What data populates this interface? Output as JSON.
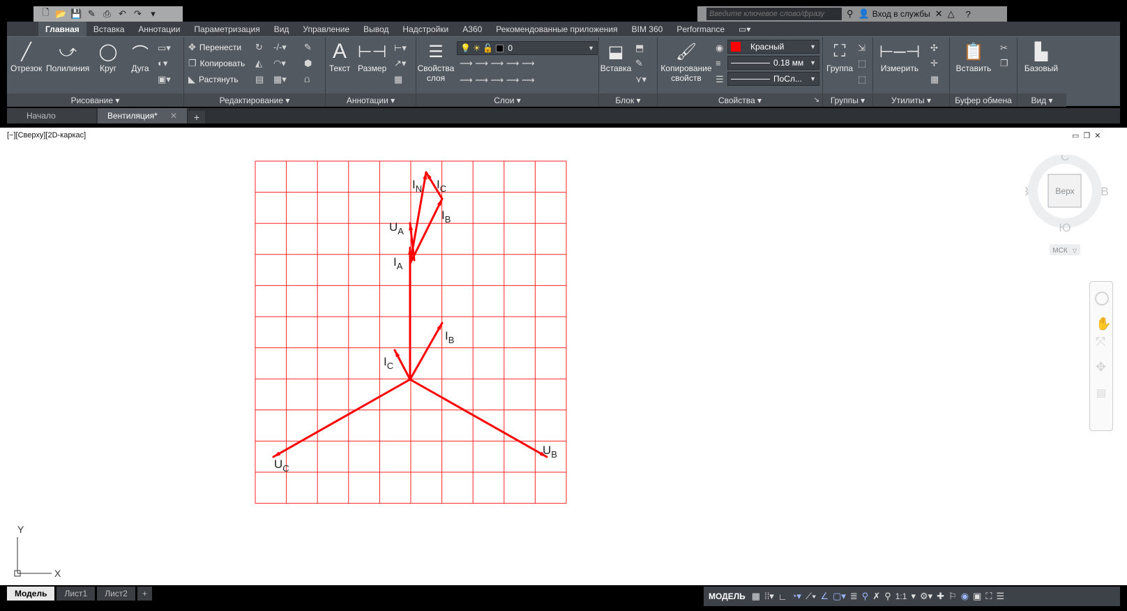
{
  "search": {
    "placeholder": "Введите ключевое слово/фразу"
  },
  "signin_label": "Вход в службы",
  "ribbon_tabs": [
    "Главная",
    "Вставка",
    "Аннотации",
    "Параметризация",
    "Вид",
    "Управление",
    "Вывод",
    "Надстройки",
    "A360",
    "Рекомендованные приложения",
    "BIM 360",
    "Performance"
  ],
  "draw_panel": {
    "line": "Отрезок",
    "polyline": "Полилиния",
    "circle": "Круг",
    "arc": "Дуга",
    "title": "Рисование"
  },
  "modify_panel": {
    "move": "Перенести",
    "copy": "Копировать",
    "stretch": "Растянуть",
    "title": "Редактирование"
  },
  "annot_panel": {
    "text": "Текст",
    "dim": "Размер",
    "title": "Аннотации"
  },
  "layers_panel": {
    "props": "Свойства слоя",
    "layer_value": "0",
    "title": "Слои"
  },
  "block_panel": {
    "insert": "Вставка",
    "title": "Блок"
  },
  "props_panel": {
    "match": "Копирование свойств",
    "color": "Красный",
    "lineweight": "0.18 мм",
    "linetype": "ПоСл...",
    "title": "Свойства"
  },
  "groups_panel": {
    "group": "Группа",
    "title": "Группы"
  },
  "utils_panel": {
    "measure": "Измерить",
    "title": "Утилиты"
  },
  "clipboard_panel": {
    "paste": "Вставить",
    "title": "Буфер обмена"
  },
  "view_panel": {
    "base": "Базовый",
    "title": "Вид"
  },
  "file_tabs": {
    "start": "Начало",
    "active": "Вентиляция*"
  },
  "viewport_label": "[−][Сверху][2D-каркас]",
  "viewcube": {
    "n": "С",
    "s": "Ю",
    "w": "З",
    "e": "В",
    "face": "Верх",
    "ucs": "МСК"
  },
  "ucs": {
    "x": "X",
    "y": "Y"
  },
  "layout_tabs": [
    "Модель",
    "Лист1",
    "Лист2"
  ],
  "status": {
    "model": "МОДЕЛЬ",
    "scale": "1:1"
  },
  "drawing": {
    "vectors": [
      {
        "name": "UA",
        "label": "U",
        "sub": "A"
      },
      {
        "name": "UB",
        "label": "U",
        "sub": "B"
      },
      {
        "name": "UC",
        "label": "U",
        "sub": "C"
      },
      {
        "name": "IA",
        "label": "I",
        "sub": "A"
      },
      {
        "name": "IB",
        "label": "I",
        "sub": "B"
      },
      {
        "name": "IC",
        "label": "I",
        "sub": "C"
      },
      {
        "name": "IB-shifted",
        "label": "I",
        "sub": "B"
      },
      {
        "name": "IC-shifted",
        "label": "I",
        "sub": "C"
      },
      {
        "name": "IN",
        "label": "I",
        "sub": "N"
      }
    ]
  },
  "colors": {
    "stroke": "#ff0000",
    "grid": "#ff2222",
    "ribbon": "#535961"
  }
}
